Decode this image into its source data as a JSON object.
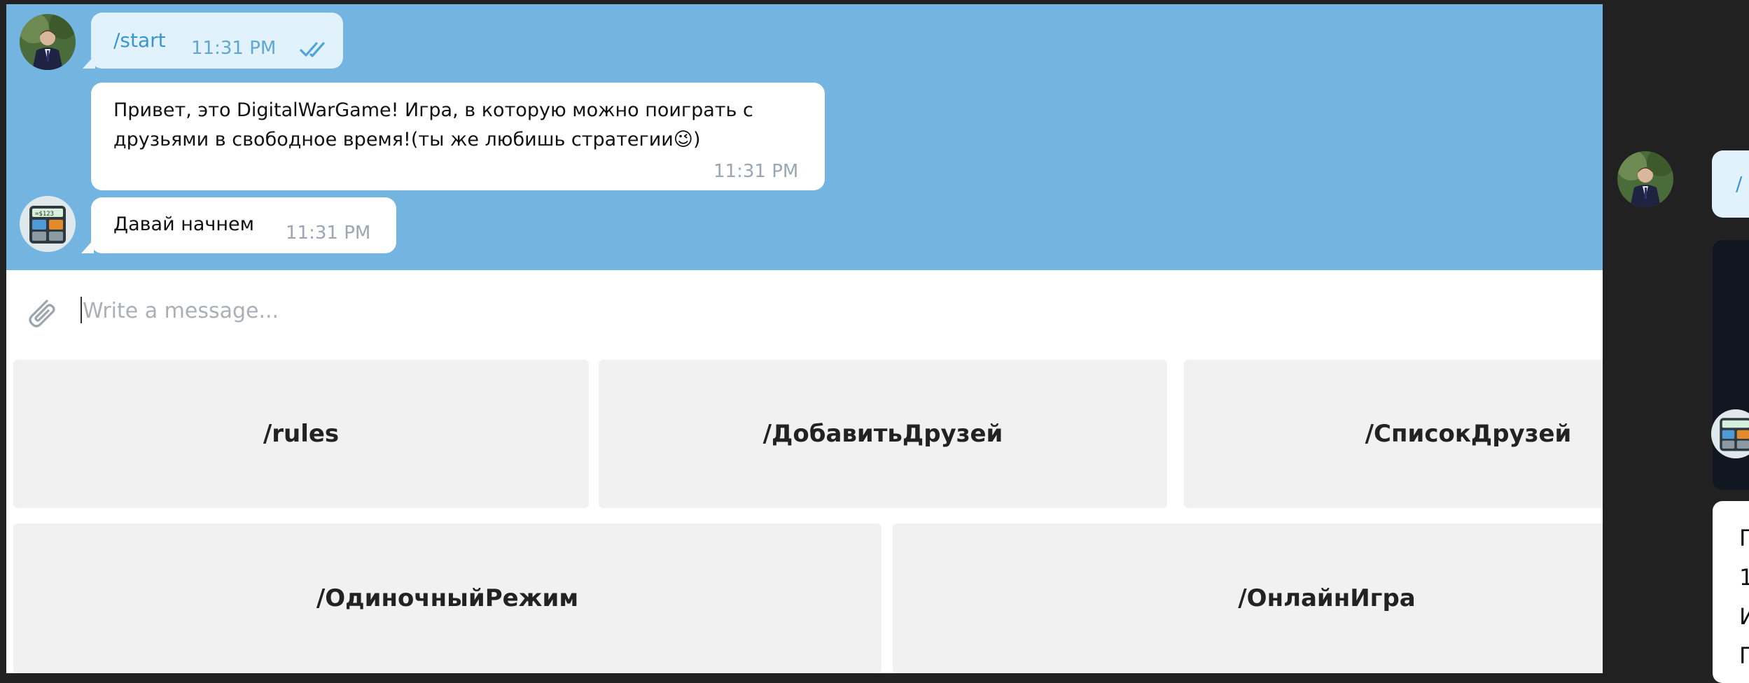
{
  "messages": [
    {
      "text": "/start",
      "time": "11:31 PM"
    },
    {
      "text": "Привет, это DigitalWarGame! Игра, в которую можно поиграть с\nдрузьями в свободное время!(ты же любишь стратегии😉)",
      "time": "11:31 PM"
    },
    {
      "text": "Давай начнем",
      "time": "11:31 PM"
    }
  ],
  "input": {
    "placeholder": "Write a message..."
  },
  "keyboard": {
    "row1": [
      "/rules",
      "/ДобавитьДрузей",
      "/СписокДрузей"
    ],
    "row2": [
      "/ОдиночныйРежим",
      "/ОнлайнИгра"
    ]
  },
  "right_panel": {
    "fragment_top": "/",
    "text_fragments": [
      "П",
      "1",
      "И",
      "П"
    ]
  },
  "icons": {
    "read_status": "double-check-icon",
    "attach": "paperclip-icon"
  },
  "colors": {
    "chat_background": "#74b4e0",
    "outgoing_bubble": "#e2f2fd",
    "command_text": "#3a96cf",
    "keyboard_button": "#f1f1f1"
  }
}
